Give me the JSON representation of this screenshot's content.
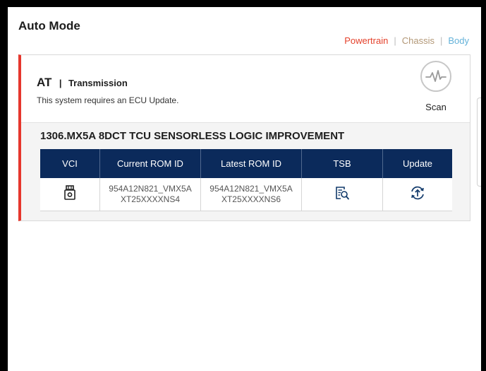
{
  "page": {
    "title": "Auto Mode"
  },
  "filters": {
    "powertrain": "Powertrain",
    "chassis": "Chassis",
    "body": "Body",
    "separator": "|"
  },
  "system": {
    "code": "AT",
    "separator": "|",
    "name": "Transmission",
    "message": "This system requires an ECU Update.",
    "scan_label": "Scan"
  },
  "update": {
    "title": "1306.MX5A 8DCT TCU SENSORLESS LOGIC IMPROVEMENT",
    "columns": [
      "VCI",
      "Current ROM ID",
      "Latest ROM ID",
      "TSB",
      "Update"
    ],
    "row": {
      "current_rom_line1": "954A12N821_VMX5A",
      "current_rom_line2": "XT25XXXXNS4",
      "latest_rom_line1": "954A12N821_VMX5A",
      "latest_rom_line2": "XT25XXXXNS6"
    }
  },
  "colors": {
    "accent_red": "#e6372d",
    "header_navy": "#0b2a5b",
    "link_blue": "#1fa3d6",
    "powertrain": "#e4412b",
    "chassis": "#b29776",
    "body": "#64b2d9"
  },
  "icons": {
    "scan": "heartbeat-scan-icon",
    "vci": "vci-device-icon",
    "tsb": "document-search-icon",
    "update": "sync-upload-icon"
  }
}
